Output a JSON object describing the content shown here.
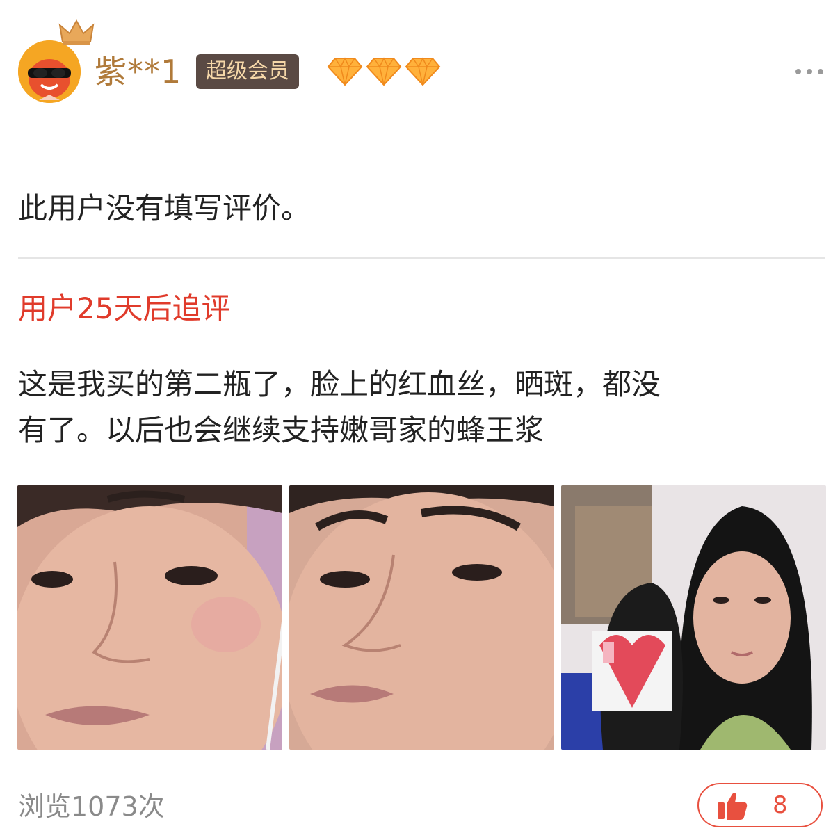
{
  "user": {
    "name": "紫**1",
    "badge": "超级会员",
    "diamond_count": 3
  },
  "review": {
    "text": "此用户没有填写评价。"
  },
  "followup": {
    "title": "用户25天后追评",
    "lines": [
      "这是我买的第二瓶了，脸上的红血丝，晒斑，都没",
      "有了。以后也会继续支持嫩哥家的蜂王浆"
    ]
  },
  "footer": {
    "views": "浏览1073次",
    "likes": "8"
  },
  "colors": {
    "username": "#b07a3a",
    "badge_bg": "#5a4a44",
    "badge_text": "#f5d7a8",
    "followup_title": "#e03b2b",
    "like_accent": "#e8503f",
    "muted": "#8a8a8a"
  },
  "icons": {
    "more": "more-dots-icon",
    "like": "thumbs-up-icon",
    "diamond": "diamond-icon",
    "crown": "crown-icon"
  }
}
